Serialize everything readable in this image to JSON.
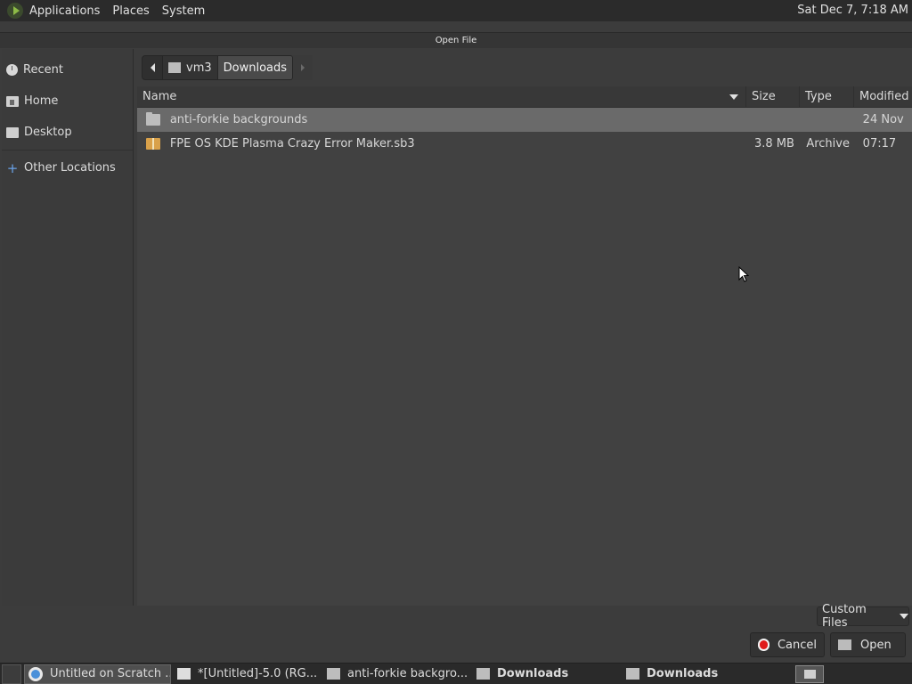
{
  "top_panel": {
    "menus": [
      "Applications",
      "Places",
      "System"
    ],
    "clock": "Sat Dec  7,  7:18 AM"
  },
  "dialog": {
    "title": "Open File"
  },
  "sidebar": {
    "items": [
      {
        "label": "Recent",
        "icon": "clock-icon"
      },
      {
        "label": "Home",
        "icon": "home-folder-icon"
      },
      {
        "label": "Desktop",
        "icon": "desktop-folder-icon"
      },
      {
        "label": "Other Locations",
        "icon": "plus-icon"
      }
    ]
  },
  "pathbar": {
    "segments": [
      "vm3",
      "Downloads"
    ]
  },
  "columns": {
    "name": "Name",
    "size": "Size",
    "type": "Type",
    "modified": "Modified"
  },
  "files": [
    {
      "name": "anti-forkie backgrounds",
      "size": "",
      "type": "",
      "modified": "24 Nov",
      "icon": "folder-icon",
      "selected": true
    },
    {
      "name": "FPE OS KDE Plasma Crazy Error Maker.sb3",
      "size": "3.8 MB",
      "type": "Archive",
      "modified": "07:17",
      "icon": "archive-icon",
      "selected": false
    }
  ],
  "footer": {
    "filter": "Custom Files",
    "cancel_label": "Cancel",
    "open_label": "Open"
  },
  "taskbar": {
    "tasks": [
      {
        "label": "Untitled on Scratch ...",
        "icon": "chrome-icon"
      },
      {
        "label": "*[Untitled]-5.0 (RG...",
        "icon": "gimp-icon"
      },
      {
        "label": "anti-forkie backgro...",
        "icon": "folder-icon"
      },
      {
        "label": "Downloads",
        "icon": "folder-icon"
      },
      {
        "label": "Downloads",
        "icon": "folder-icon"
      }
    ]
  }
}
